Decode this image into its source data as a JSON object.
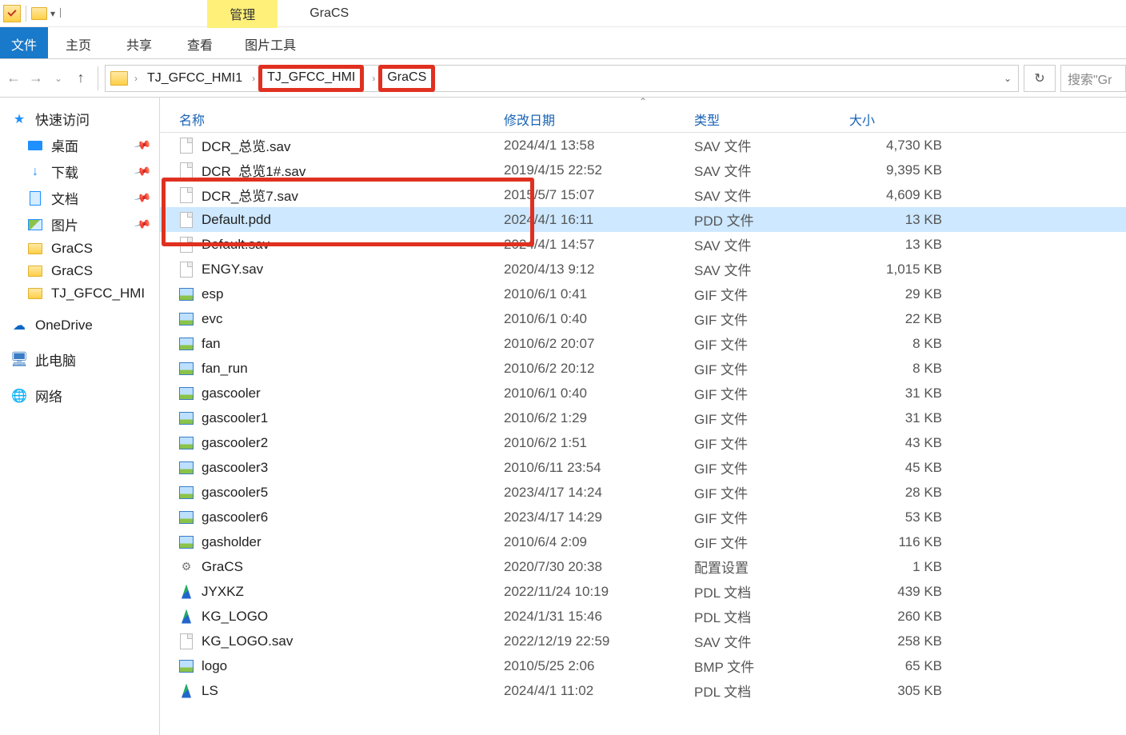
{
  "titlebar": {
    "context_tab": "管理",
    "window_title": "GraCS"
  },
  "ribbon": {
    "file": "文件",
    "tabs": [
      "主页",
      "共享",
      "查看"
    ],
    "tool_tab": "图片工具"
  },
  "breadcrumb": {
    "items": [
      "TJ_GFCC_HMI1",
      "TJ_GFCC_HMI",
      "GraCS"
    ]
  },
  "search": {
    "placeholder": "搜索\"Gr"
  },
  "sidebar": {
    "quick": "快速访问",
    "desktop": "桌面",
    "downloads": "下载",
    "documents": "文档",
    "pictures": "图片",
    "folders": [
      "GraCS",
      "GraCS",
      "TJ_GFCC_HMI"
    ],
    "onedrive": "OneDrive",
    "thispc": "此电脑",
    "network": "网络"
  },
  "columns": {
    "name": "名称",
    "date": "修改日期",
    "type": "类型",
    "size": "大小"
  },
  "files": [
    {
      "name": "DCR_总览.sav",
      "date": "2024/4/1 13:58",
      "type": "SAV 文件",
      "size": "4,730 KB",
      "icon": "file"
    },
    {
      "name": "DCR_总览1#.sav",
      "date": "2019/4/15 22:52",
      "type": "SAV 文件",
      "size": "9,395 KB",
      "icon": "file"
    },
    {
      "name": "DCR_总览7.sav",
      "date": "2015/5/7 15:07",
      "type": "SAV 文件",
      "size": "4,609 KB",
      "icon": "file"
    },
    {
      "name": "Default.pdd",
      "date": "2024/4/1 16:11",
      "type": "PDD 文件",
      "size": "13 KB",
      "icon": "file",
      "selected": true
    },
    {
      "name": "Default.sav",
      "date": "2024/4/1 14:57",
      "type": "SAV 文件",
      "size": "13 KB",
      "icon": "file"
    },
    {
      "name": "ENGY.sav",
      "date": "2020/4/13 9:12",
      "type": "SAV 文件",
      "size": "1,015 KB",
      "icon": "file"
    },
    {
      "name": "esp",
      "date": "2010/6/1 0:41",
      "type": "GIF 文件",
      "size": "29 KB",
      "icon": "img"
    },
    {
      "name": "evc",
      "date": "2010/6/1 0:40",
      "type": "GIF 文件",
      "size": "22 KB",
      "icon": "img"
    },
    {
      "name": "fan",
      "date": "2010/6/2 20:07",
      "type": "GIF 文件",
      "size": "8 KB",
      "icon": "img"
    },
    {
      "name": "fan_run",
      "date": "2010/6/2 20:12",
      "type": "GIF 文件",
      "size": "8 KB",
      "icon": "img"
    },
    {
      "name": "gascooler",
      "date": "2010/6/1 0:40",
      "type": "GIF 文件",
      "size": "31 KB",
      "icon": "img"
    },
    {
      "name": "gascooler1",
      "date": "2010/6/2 1:29",
      "type": "GIF 文件",
      "size": "31 KB",
      "icon": "img"
    },
    {
      "name": "gascooler2",
      "date": "2010/6/2 1:51",
      "type": "GIF 文件",
      "size": "43 KB",
      "icon": "img"
    },
    {
      "name": "gascooler3",
      "date": "2010/6/11 23:54",
      "type": "GIF 文件",
      "size": "45 KB",
      "icon": "img"
    },
    {
      "name": "gascooler5",
      "date": "2023/4/17 14:24",
      "type": "GIF 文件",
      "size": "28 KB",
      "icon": "img"
    },
    {
      "name": "gascooler6",
      "date": "2023/4/17 14:29",
      "type": "GIF 文件",
      "size": "53 KB",
      "icon": "img"
    },
    {
      "name": "gasholder",
      "date": "2010/6/4 2:09",
      "type": "GIF 文件",
      "size": "116 KB",
      "icon": "img"
    },
    {
      "name": "GraCS",
      "date": "2020/7/30 20:38",
      "type": "配置设置",
      "size": "1 KB",
      "icon": "cfg"
    },
    {
      "name": "JYXKZ",
      "date": "2022/11/24 10:19",
      "type": "PDL 文档",
      "size": "439 KB",
      "icon": "pdl"
    },
    {
      "name": "KG_LOGO",
      "date": "2024/1/31 15:46",
      "type": "PDL 文档",
      "size": "260 KB",
      "icon": "pdl"
    },
    {
      "name": "KG_LOGO.sav",
      "date": "2022/12/19 22:59",
      "type": "SAV 文件",
      "size": "258 KB",
      "icon": "file"
    },
    {
      "name": "logo",
      "date": "2010/5/25 2:06",
      "type": "BMP 文件",
      "size": "65 KB",
      "icon": "img"
    },
    {
      "name": "LS",
      "date": "2024/4/1 11:02",
      "type": "PDL 文档",
      "size": "305 KB",
      "icon": "pdl"
    }
  ]
}
